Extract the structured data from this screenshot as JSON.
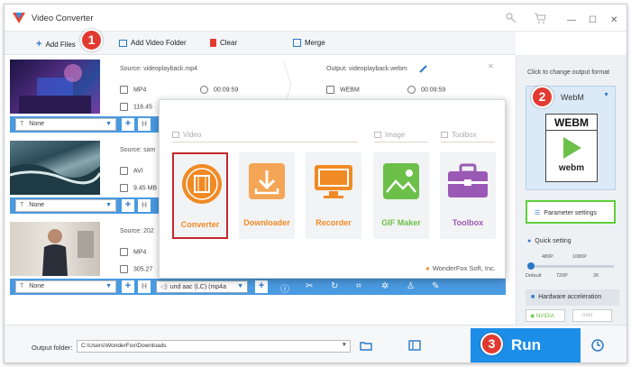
{
  "app": {
    "title": "Video Converter"
  },
  "toolbar": {
    "add_files": "Add Files",
    "add_folder": "Add Video Folder",
    "clear": "Clear",
    "merge": "Merge"
  },
  "steps": {
    "one": "1",
    "two": "2",
    "three": "3"
  },
  "files": [
    {
      "source": "Source: videoplayback.mp4",
      "output": "Output: videoplayback.webm",
      "src_format": "MP4",
      "src_duration": "00:09:59",
      "src_size": "116.45",
      "out_format": "WEBM",
      "out_duration": "00:09:59",
      "subtitle": "None"
    },
    {
      "source": "Source: sam",
      "src_format": "AVI",
      "src_size": "9.45 MB",
      "subtitle": "None"
    },
    {
      "source": "Source: 202",
      "src_format": "MP4",
      "src_size": "305.27",
      "subtitle": "None",
      "audio": "und aac (LC) (mp4a"
    }
  ],
  "popup": {
    "sections": {
      "video": "Video",
      "image": "Image",
      "toolbox": "Toolbox"
    },
    "tiles": [
      "Converter",
      "Downloader",
      "Recorder",
      "GIF Maker",
      "Toolbox"
    ],
    "brand": "WonderFox Soft, Inc."
  },
  "sidebar": {
    "hint": "Click to change output format",
    "format": "WebM",
    "format_badge": "WEBM",
    "format_logo": "webm",
    "param_btn": "Parameter settings",
    "quick_setting": "Quick setting",
    "quality_labels_top": [
      "480P",
      "1080P"
    ],
    "quality_labels_bottom": [
      "Default",
      "720P",
      "2K"
    ],
    "hw_accel": "Hardware acceleration",
    "nvidia": "NVIDIA",
    "intel": "Intel"
  },
  "bottom": {
    "folder_label": "Output folder:",
    "folder_path": "C:\\Users\\WonderFox\\Downloads",
    "run": "Run"
  },
  "colors": {
    "accent": "#4a9ae1",
    "badge": "#e23a31",
    "run": "#1c8ee8",
    "orange": "#f08a24",
    "green": "#6cc04a",
    "purple": "#9b59b6"
  }
}
